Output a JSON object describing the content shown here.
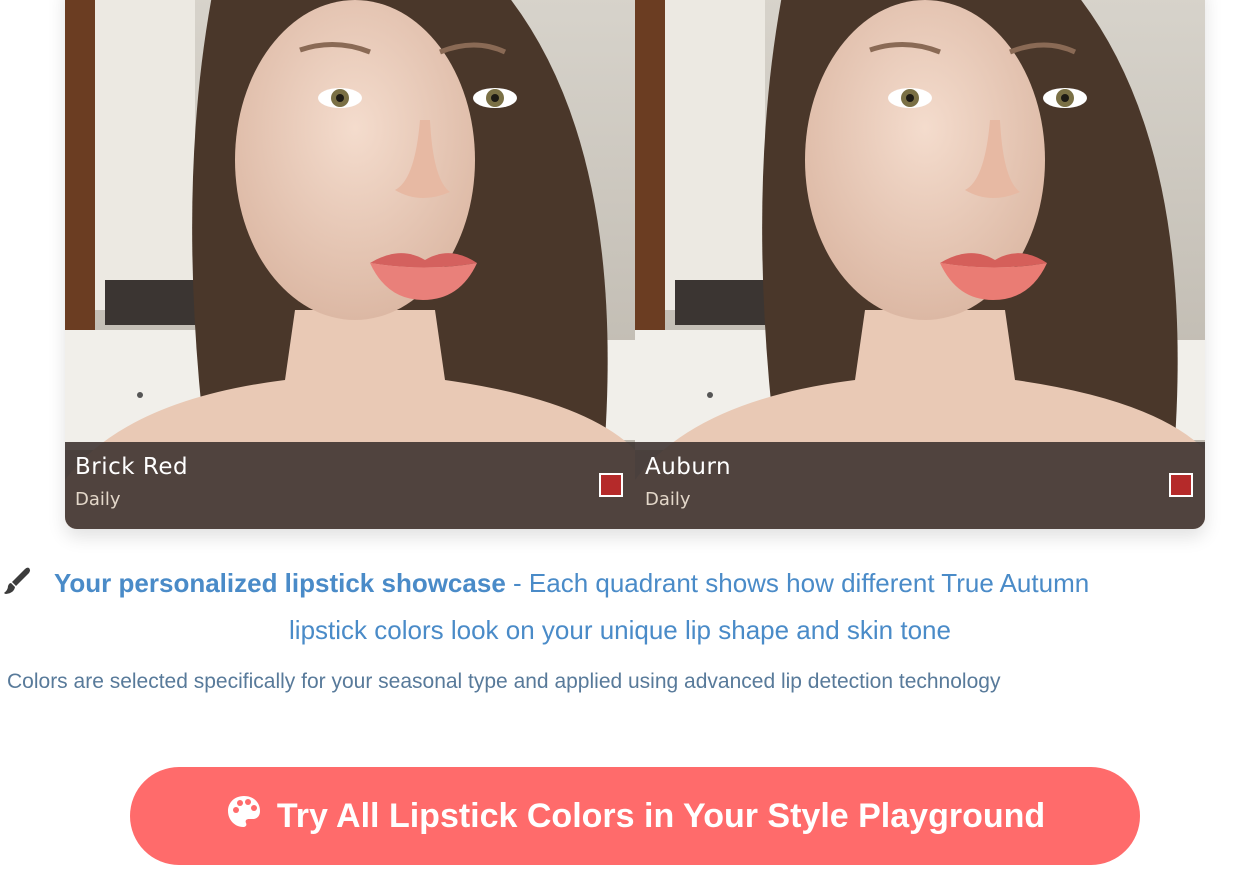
{
  "showcase": {
    "quadrants": [
      {
        "shade_name": "Brick Red",
        "usage": "Daily",
        "swatch_color": "#b52a2a",
        "photo_icon": "portrait-photo"
      },
      {
        "shade_name": "Auburn",
        "usage": "Daily",
        "swatch_color": "#b52a2a",
        "photo_icon": "portrait-photo"
      }
    ]
  },
  "description": {
    "icon": "paintbrush-icon",
    "bold_text": "Your personalized lipstick showcase",
    "text_part1": " - Each quadrant shows how different True Autumn",
    "text_part2": "lipstick colors look on your unique lip shape and skin tone"
  },
  "note": "Colors are selected specifically for your seasonal type and applied using advanced lip detection technology",
  "cta": {
    "icon": "palette-icon",
    "label": "Try All Lipstick Colors in Your Style Playground",
    "color": "#ff6b6b"
  }
}
